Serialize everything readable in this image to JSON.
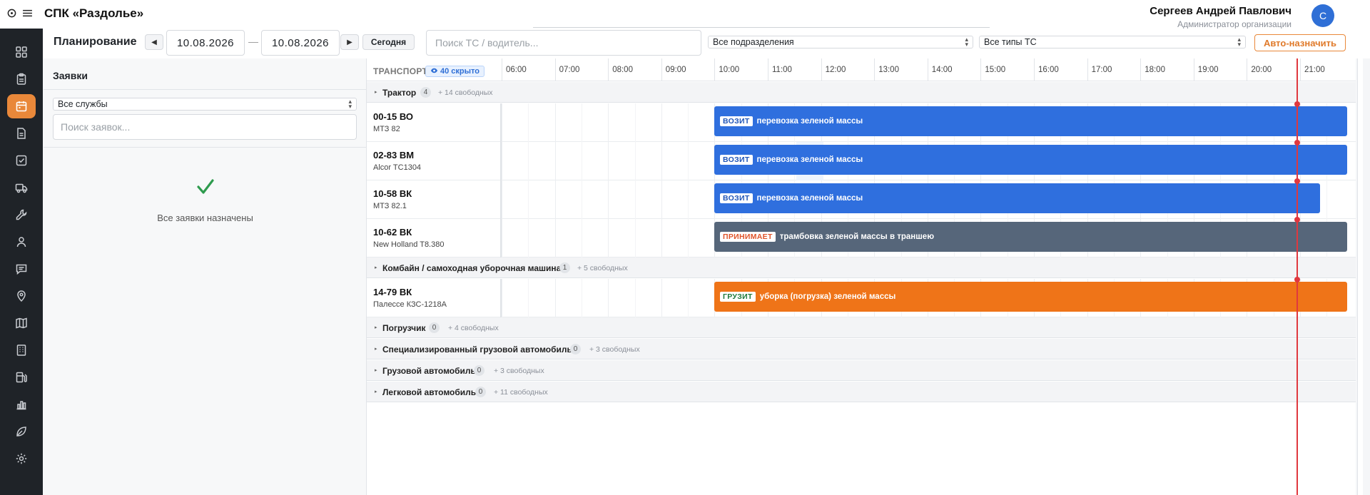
{
  "header": {
    "app_title": "СПК «Раздолье»",
    "user_name": "Сергеев Андрей Павлович",
    "user_role": "Администратор организации",
    "avatar_letter": "С"
  },
  "sidebar": {
    "items": [
      {
        "icon": "dashboard-icon",
        "active": false
      },
      {
        "icon": "clipboard-icon",
        "active": false
      },
      {
        "icon": "calendar-icon",
        "active": true
      },
      {
        "icon": "document-icon",
        "active": false
      },
      {
        "icon": "checkbox-icon",
        "active": false
      },
      {
        "icon": "truck-icon",
        "active": false
      },
      {
        "icon": "wrench-icon",
        "active": false
      },
      {
        "icon": "user-icon",
        "active": false
      },
      {
        "icon": "chat-icon",
        "active": false
      },
      {
        "icon": "map-pin-icon",
        "active": false
      },
      {
        "icon": "map-icon",
        "active": false
      },
      {
        "icon": "building-icon",
        "active": false
      },
      {
        "icon": "fuel-icon",
        "active": false
      },
      {
        "icon": "bar-chart-icon",
        "active": false
      },
      {
        "icon": "leaf-icon",
        "active": false
      },
      {
        "icon": "gear-icon",
        "active": false
      }
    ]
  },
  "toolbar": {
    "page_title": "Планирование",
    "prev_label": "◀",
    "next_label": "▶",
    "date_from": "10.08.2026",
    "date_separator": "—",
    "date_to": "10.08.2026",
    "today_label": "Сегодня",
    "search_placeholder": "Поиск ТС / водитель...",
    "division_select": "Все подразделения",
    "type_select": "Все типы ТС",
    "auto_assign_label": "Авто-назначить"
  },
  "requests_panel": {
    "title": "Заявки",
    "service_select": "Все службы",
    "search_placeholder": "Поиск заявок...",
    "empty_message": "Все заявки назначены",
    "check_color": "#2e9b4e"
  },
  "gantt": {
    "transport_label": "ТРАНСПОРТ",
    "hidden_badge": "40 скрыто",
    "hours": [
      "06:00",
      "07:00",
      "08:00",
      "09:00",
      "10:00",
      "11:00",
      "12:00",
      "13:00",
      "14:00",
      "15:00",
      "16:00",
      "17:00",
      "18:00",
      "19:00",
      "20:00",
      "21:00"
    ],
    "groups": [
      {
        "name": "Трактор",
        "count": "4",
        "free": "+ 14 свободных",
        "vehicles": [
          {
            "plate": "00-15 ВО",
            "model": "МТЗ 82",
            "task": {
              "tag": "ВОЗИТ",
              "text": "перевозка зеленой массы",
              "color": "blue"
            }
          },
          {
            "plate": "02-83 ВМ",
            "model": "Alcor TC1304",
            "task": {
              "tag": "ВОЗИТ",
              "text": "перевозка зеленой массы",
              "color": "blue"
            }
          },
          {
            "plate": "10-58 ВК",
            "model": "МТЗ 82.1",
            "task": {
              "tag": "ВОЗИТ",
              "text": "перевозка зеленой массы",
              "color": "blue"
            }
          },
          {
            "plate": "10-62 ВК",
            "model": "New Holland T8.380",
            "task": {
              "tag": "ПРИНИМАЕТ",
              "text": "трамбовка зеленой массы в траншею",
              "color": "slate"
            }
          }
        ]
      },
      {
        "name": "Комбайн / самоходная уборочная машина",
        "count": "1",
        "free": "+ 5 свободных",
        "vehicles": [
          {
            "plate": "14-79 ВК",
            "model": "Палессе КЗС-1218А",
            "task": {
              "tag": "ГРУЗИТ",
              "text": "уборка (погрузка) зеленой массы",
              "color": "orange"
            }
          }
        ]
      },
      {
        "name": "Погрузчик",
        "count": "0",
        "free": "+ 4 свободных",
        "vehicles": []
      },
      {
        "name": "Специализированный грузовой автомобиль",
        "count": "0",
        "free": "+ 3 свободных",
        "vehicles": []
      },
      {
        "name": "Грузовой автомобиль",
        "count": "0",
        "free": "+ 3 свободных",
        "vehicles": []
      },
      {
        "name": "Легковой автомобиль",
        "count": "0",
        "free": "+ 11 свободных",
        "vehicles": []
      }
    ]
  },
  "colors": {
    "accent_orange": "#e9883a",
    "task_blue": "#2f6fde",
    "task_slate": "#56667a",
    "task_orange": "#ef7418",
    "now_line": "#e0383e",
    "sidebar_bg": "#1f2328"
  }
}
